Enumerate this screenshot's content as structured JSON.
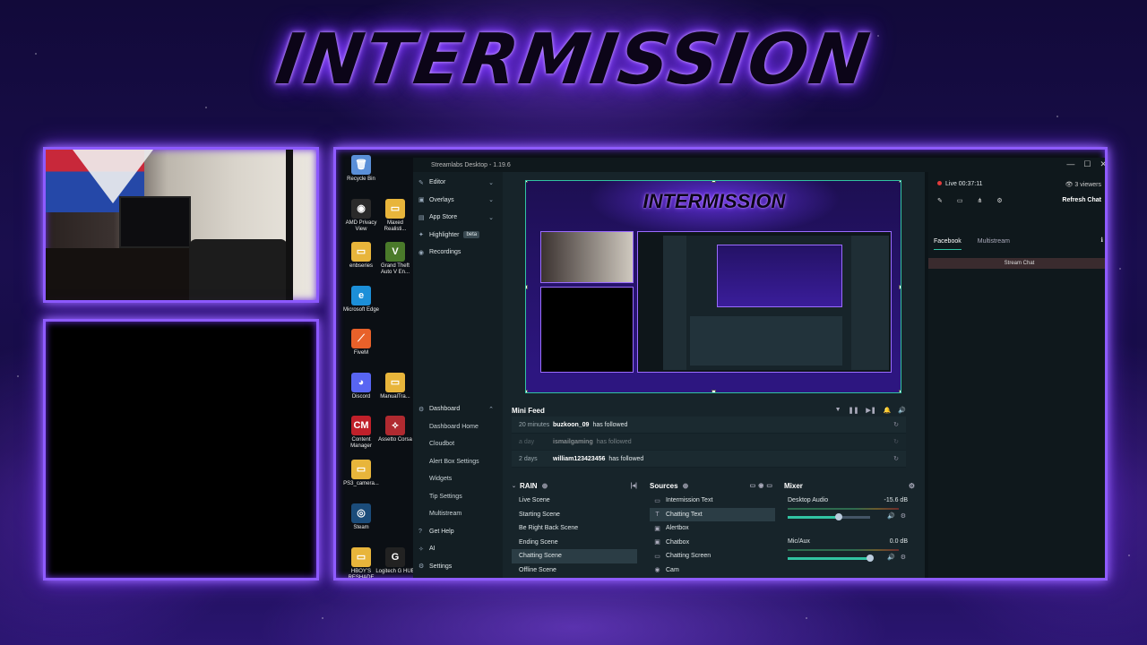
{
  "overlay": {
    "title": "INTERMISSION"
  },
  "desktop_icons": [
    {
      "name": "recycle-bin-icon",
      "label": "Recycle Bin",
      "glyph": "🗑",
      "color": "#5a8fd8"
    },
    {
      "name": "amd-privacy-icon",
      "label": "AMD Privacy View",
      "glyph": "◉",
      "color": "#2a2a2a"
    },
    {
      "name": "maxed-folder-icon",
      "label": "Maxed Realisti...",
      "glyph": "▭",
      "color": "#e8b53b"
    },
    {
      "name": "enbseries-folder-icon",
      "label": "enbseries",
      "glyph": "▭",
      "color": "#e8b53b"
    },
    {
      "name": "gta-icon",
      "label": "Grand Theft Auto V En...",
      "glyph": "V",
      "color": "#4a7a2a"
    },
    {
      "name": "edge-icon",
      "label": "Microsoft Edge",
      "glyph": "e",
      "color": "#1c8fd8"
    },
    {
      "name": "fivem-icon",
      "label": "FiveM",
      "glyph": "⟋",
      "color": "#e8612a"
    },
    {
      "name": "discord-icon",
      "label": "Discord",
      "glyph": "◕",
      "color": "#5865f2"
    },
    {
      "name": "manualtra-folder-icon",
      "label": "ManualTra...",
      "glyph": "▭",
      "color": "#e8b53b"
    },
    {
      "name": "content-manager-icon",
      "label": "Content Manager",
      "glyph": "CM",
      "color": "#c0202a"
    },
    {
      "name": "assetto-corsa-icon",
      "label": "Assetto Corsa",
      "glyph": "⟡",
      "color": "#b02a30"
    },
    {
      "name": "ps3-folder-icon",
      "label": "PS3_camera...",
      "glyph": "▭",
      "color": "#e8b53b"
    },
    {
      "name": "steam-icon",
      "label": "Steam",
      "glyph": "◎",
      "color": "#1b4c7a"
    },
    {
      "name": "hboys-folder-icon",
      "label": "HBOY'S RESHADE",
      "glyph": "▭",
      "color": "#e8b53b"
    },
    {
      "name": "logitech-icon",
      "label": "Logitech G HUB",
      "glyph": "G",
      "color": "#222"
    }
  ],
  "window": {
    "title": "Streamlabs Desktop - 1.19.6",
    "min": "—",
    "max": "☐",
    "close": "✕"
  },
  "nav": {
    "top": [
      {
        "label": "Editor",
        "icon": "✎",
        "chev": "⌄"
      },
      {
        "label": "Overlays",
        "icon": "▣",
        "chev": "⌄"
      },
      {
        "label": "App Store",
        "icon": "▤",
        "chev": "⌄"
      },
      {
        "label": "Highlighter",
        "icon": "✦",
        "badge": "beta"
      },
      {
        "label": "Recordings",
        "icon": "◉"
      }
    ],
    "dashboard": {
      "label": "Dashboard",
      "icon": "⚙",
      "chev": "⌃"
    },
    "dashboard_items": [
      "Dashboard Home",
      "Cloudbot",
      "Alert Box Settings",
      "Widgets",
      "Tip Settings",
      "Multistream"
    ],
    "bottom": [
      {
        "label": "Get Help",
        "icon": "?"
      },
      {
        "label": "AI",
        "icon": "✧"
      },
      {
        "label": "Settings",
        "icon": "⚙"
      }
    ]
  },
  "minifeed": {
    "title": "Mini Feed",
    "tools": [
      "▼",
      "❚❚",
      "▶❚",
      "🔔",
      "🔊"
    ],
    "events": [
      {
        "time": "20 minutes",
        "user": "buzkoon_09",
        "action": "has followed",
        "dim": false
      },
      {
        "time": "a day",
        "user": "ismailgaming",
        "action": "has followed",
        "dim": true
      },
      {
        "time": "2 days",
        "user": "william123423456",
        "action": "has followed",
        "dim": false
      }
    ],
    "refresh": "↻"
  },
  "scenes": {
    "title": "RAIN",
    "add": "⊕",
    "items": [
      "Live Scene",
      "Starting Scene",
      "Be Right Back Scene",
      "Ending Scene",
      "Chatting Scene",
      "Offline Scene"
    ],
    "selected_index": 4
  },
  "sources": {
    "title": "Sources",
    "add": "⊕",
    "items": [
      {
        "label": "Intermission Text",
        "icon": "▭"
      },
      {
        "label": "Chatting Text",
        "icon": "T"
      },
      {
        "label": "Alertbox",
        "icon": "▣"
      },
      {
        "label": "Chatbox",
        "icon": "▣"
      },
      {
        "label": "Chatting Screen",
        "icon": "▭"
      },
      {
        "label": "Cam",
        "icon": "◉"
      }
    ],
    "selected_index": 1
  },
  "mixer": {
    "title": "Mixer",
    "gear": "⚙",
    "channels": [
      {
        "name": "Desktop Audio",
        "db": "-15.6 dB",
        "level": 0.62
      },
      {
        "name": "Mic/Aux",
        "db": "0.0 dB",
        "level": 1.0
      }
    ]
  },
  "chat": {
    "live_label": "Live 00:37:11",
    "viewers": "3 viewers",
    "refresh": "Refresh Chat",
    "tabs": [
      "Facebook",
      "Multistream"
    ],
    "stream_chat": "Stream Chat",
    "info": "ℹ"
  },
  "colors": {
    "accent": "#31c3a2",
    "frame": "#8e5bff",
    "panel": "#17242a",
    "nav": "#131e23"
  }
}
